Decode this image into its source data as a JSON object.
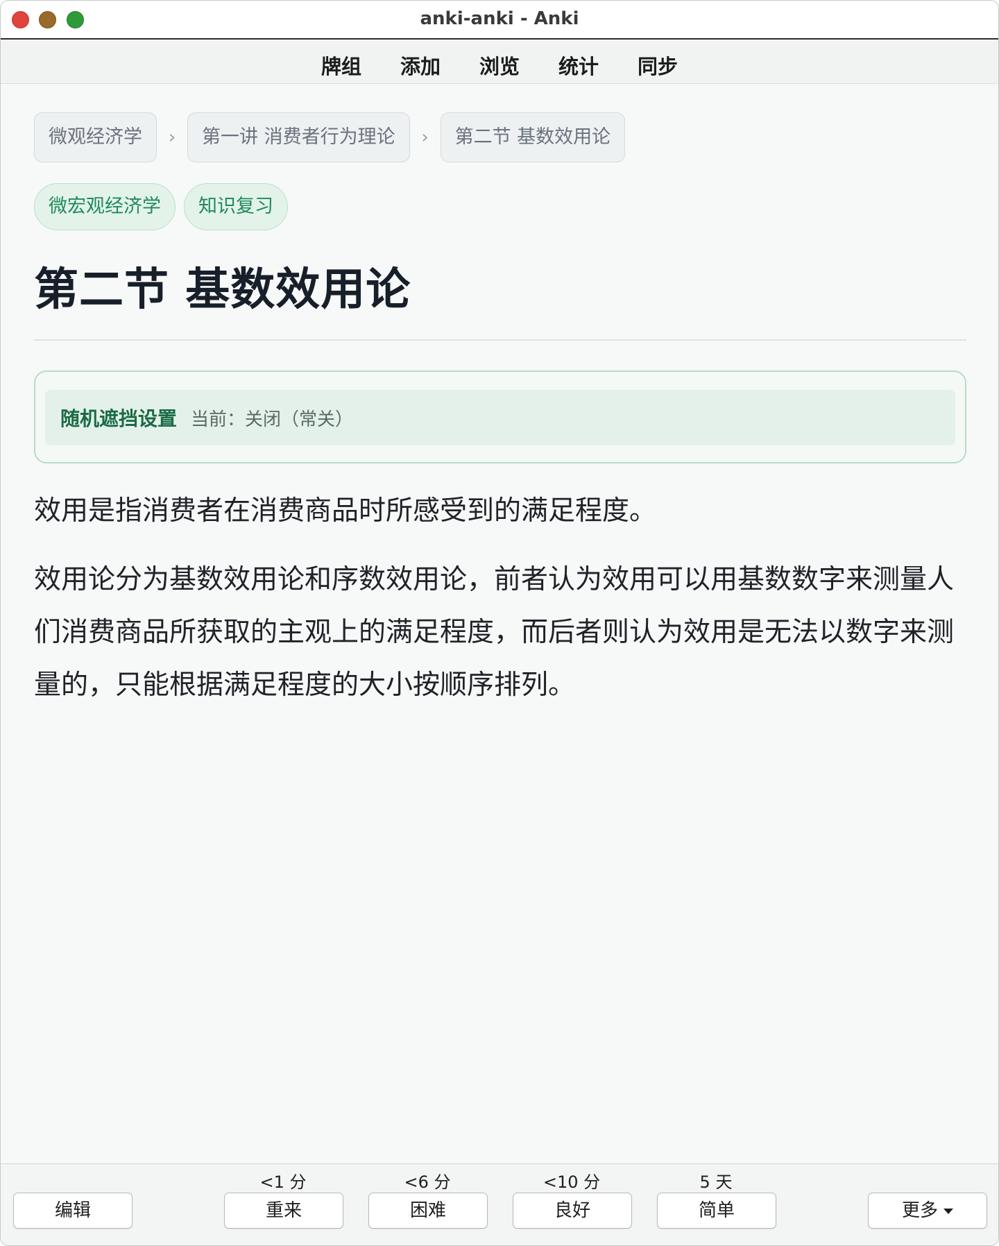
{
  "window": {
    "title": "anki-anki - Anki"
  },
  "topnav": {
    "items": [
      "牌组",
      "添加",
      "浏览",
      "统计",
      "同步"
    ]
  },
  "breadcrumb": [
    "微观经济学",
    "第一讲 消费者行为理论",
    "第二节 基数效用论"
  ],
  "breadcrumb_separator": "›",
  "tags": [
    "微宏观经济学",
    "知识复习"
  ],
  "page_title": "第二节 基数效用论",
  "random_mask": {
    "label": "随机遮挡设置",
    "status": "当前：关闭（常关）"
  },
  "paragraphs": [
    "效用是指消费者在消费商品时所感受到的满足程度。",
    "效用论分为基数效用论和序数效用论，前者认为效用可以用基数数字来测量人们消费商品所获取的主观上的满足程度，而后者则认为效用是无法以数字来测量的，只能根据满足程度的大小按顺序排列。"
  ],
  "bottom": {
    "edit_label": "编辑",
    "more_label": "更多",
    "answers": [
      {
        "interval": "<1 分",
        "label": "重来"
      },
      {
        "interval": "<6 分",
        "label": "困难"
      },
      {
        "interval": "<10 分",
        "label": "良好"
      },
      {
        "interval": "5 天",
        "label": "简单"
      }
    ]
  },
  "colors": {
    "accent_green": "#1f8a5a",
    "traffic_red": "#e0443e",
    "traffic_yellow": "#9a6a2a",
    "traffic_green": "#2f9a3a"
  }
}
